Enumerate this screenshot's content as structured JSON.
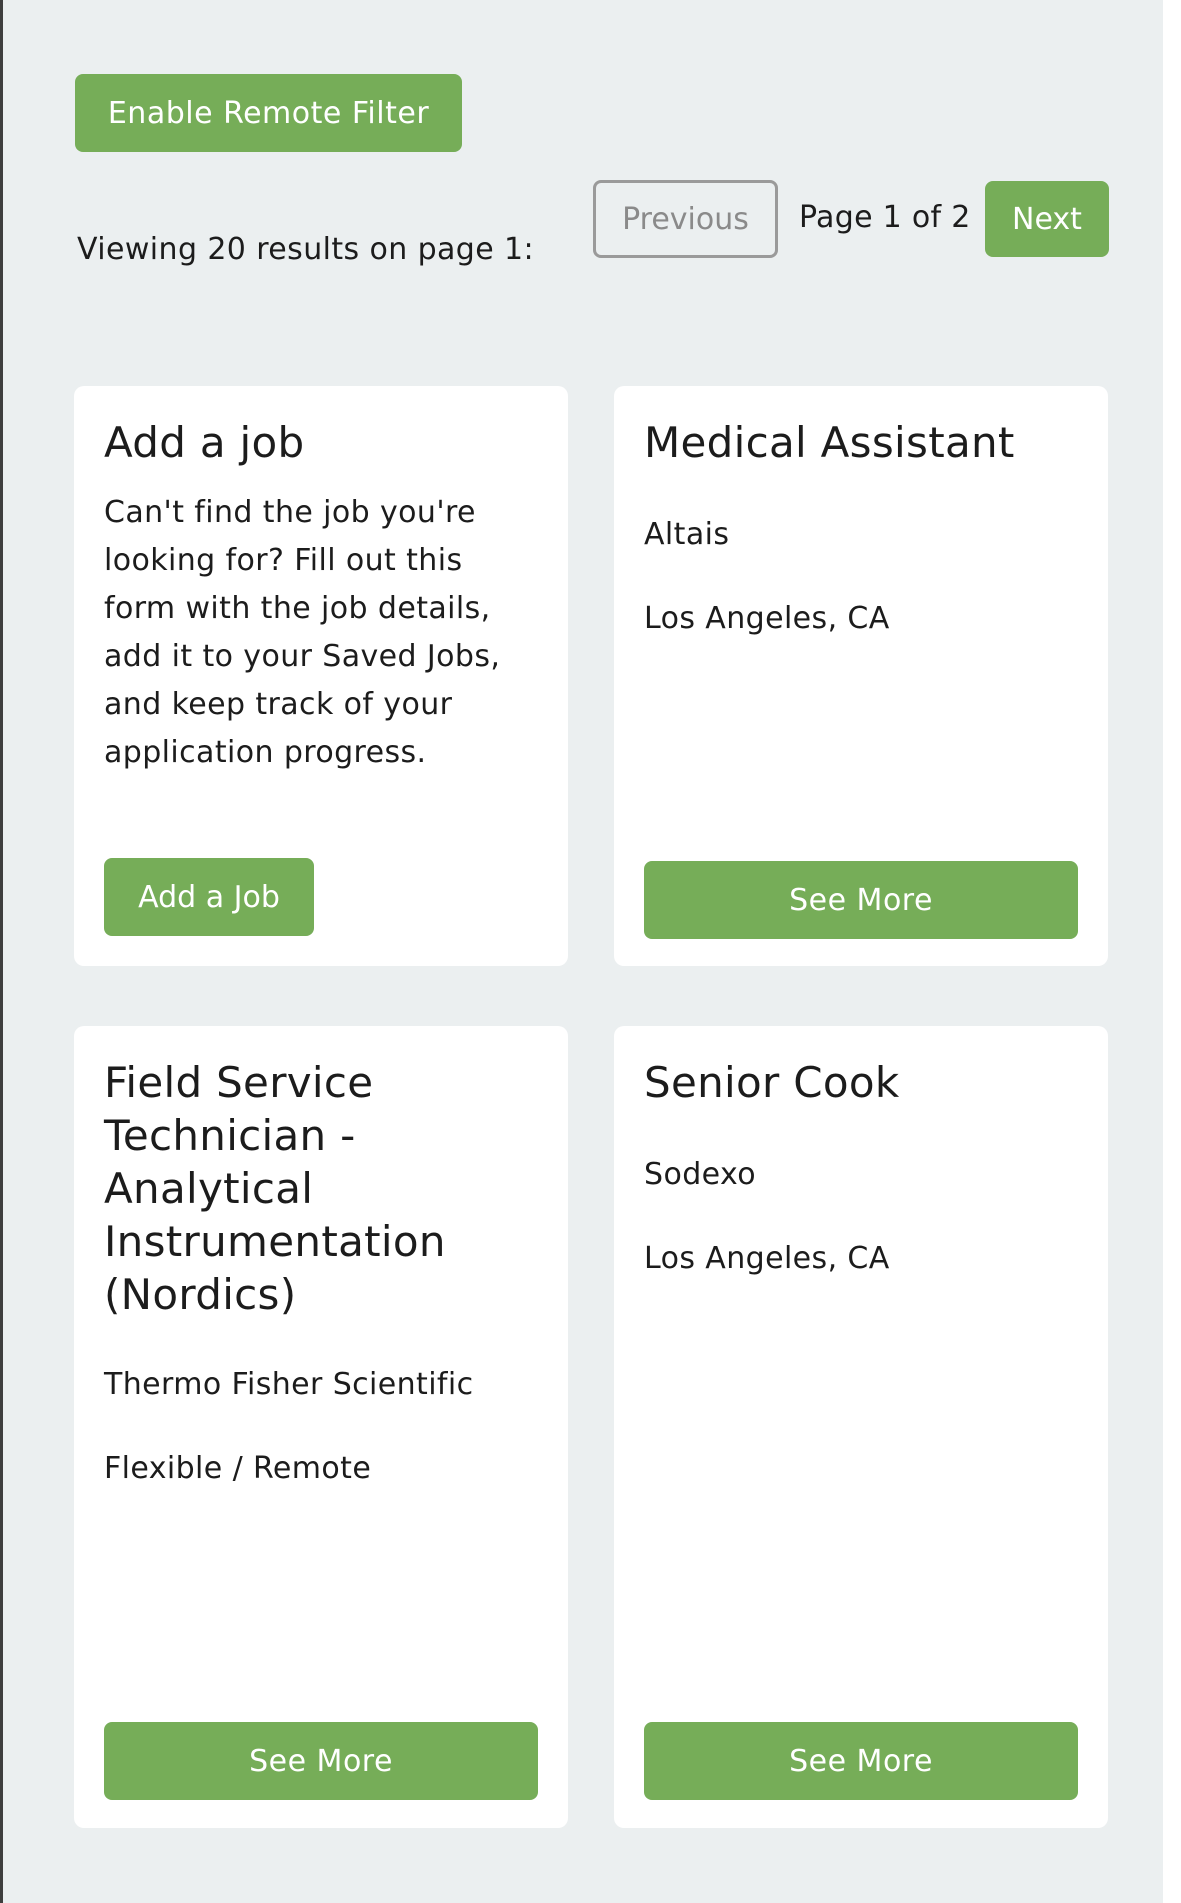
{
  "toolbar": {
    "remote_filter_label": "Enable Remote Filter",
    "results_text": "Viewing 20 results on page 1:"
  },
  "pagination": {
    "previous_label": "Previous",
    "page_label": "Page 1 of 2",
    "next_label": "Next"
  },
  "add_job_card": {
    "title": "Add a job",
    "description": "Can't find the job you're looking for? Fill out this form with the job details, add it to your Saved Jobs, and keep track of your application progress.",
    "button_label": "Add a Job"
  },
  "jobs": [
    {
      "title": "Medical Assistant",
      "company": "Altais",
      "location": "Los Angeles, CA",
      "button_label": "See More"
    },
    {
      "title": "Field Service Technician - Analytical Instrumentation (Nordics)",
      "company": "Thermo Fisher Scientific",
      "location": "Flexible / Remote",
      "button_label": "See More"
    },
    {
      "title": "Senior Cook",
      "company": "Sodexo",
      "location": "Los Angeles, CA",
      "button_label": "See More"
    }
  ],
  "colors": {
    "accent_green": "#76ad58",
    "page_background": "#ebeff0",
    "card_background": "#ffffff"
  }
}
